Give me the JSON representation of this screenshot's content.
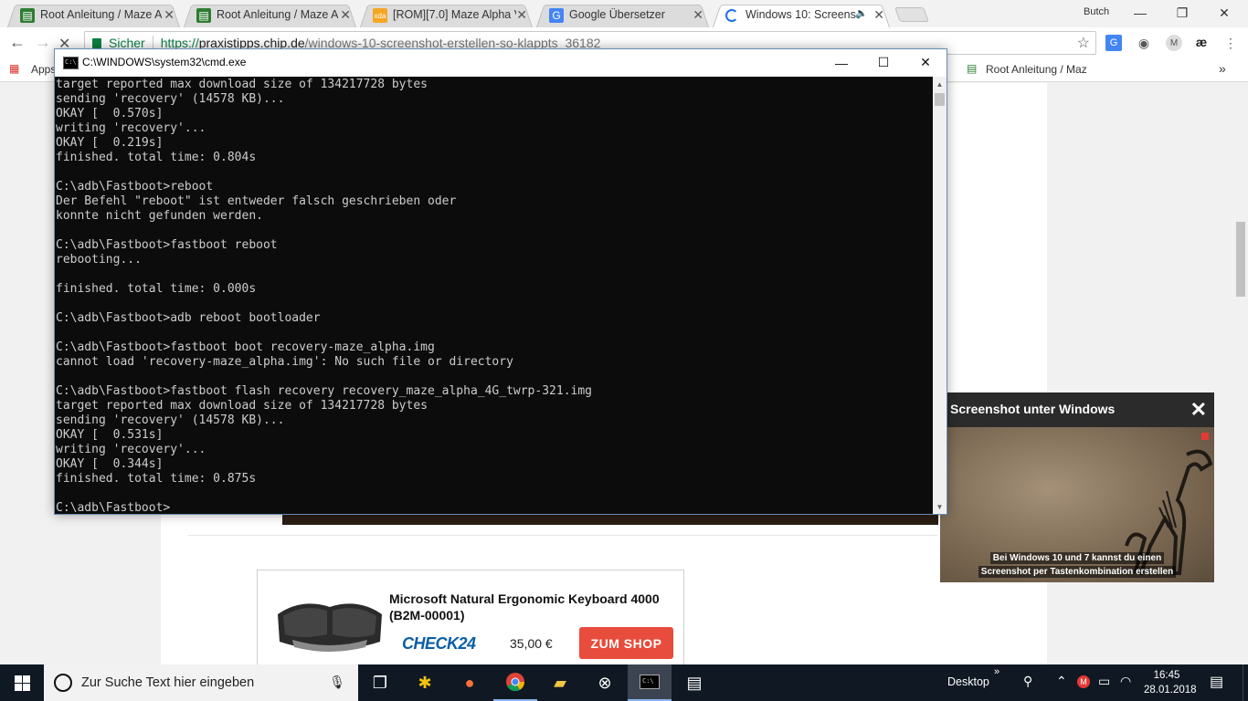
{
  "browser": {
    "tabs": [
      {
        "title": "Root Anleitung / Maze A",
        "favicon": "document-icon",
        "active": false
      },
      {
        "title": "Root Anleitung / Maze A",
        "favicon": "document-icon",
        "active": false
      },
      {
        "title": "[ROM][7.0] Maze Alpha V",
        "favicon": "xda-icon",
        "active": false
      },
      {
        "title": "Google Übersetzer",
        "favicon": "translate-icon",
        "active": false
      },
      {
        "title": "Windows 10: Screens",
        "favicon": "loading-icon",
        "active": true
      }
    ],
    "profile_name": "Butch",
    "omnibox": {
      "secure_label": "Sicher",
      "url_scheme": "https://",
      "url_host": "praxistipps.chip.de",
      "url_path": "/windows-10-screenshot-erstellen-so-klappts_36182"
    },
    "bookmarks": {
      "apps_label": "Apps",
      "items": [
        {
          "label": "Root Anleitung / Maz"
        }
      ],
      "overflow": "»"
    }
  },
  "cmd_window": {
    "title": "C:\\WINDOWS\\system32\\cmd.exe",
    "lines": [
      "target reported max download size of 134217728 bytes",
      "sending 'recovery' (14578 KB)...",
      "OKAY [  0.570s]",
      "writing 'recovery'...",
      "OKAY [  0.219s]",
      "finished. total time: 0.804s",
      "",
      "C:\\adb\\Fastboot>reboot",
      "Der Befehl \"reboot\" ist entweder falsch geschrieben oder",
      "konnte nicht gefunden werden.",
      "",
      "C:\\adb\\Fastboot>fastboot reboot",
      "rebooting...",
      "",
      "finished. total time: 0.000s",
      "",
      "C:\\adb\\Fastboot>adb reboot bootloader",
      "",
      "C:\\adb\\Fastboot>fastboot boot recovery-maze_alpha.img",
      "cannot load 'recovery-maze_alpha.img': No such file or directory",
      "",
      "C:\\adb\\Fastboot>fastboot flash recovery recovery_maze_alpha_4G_twrp-321.img",
      "target reported max download size of 134217728 bytes",
      "sending 'recovery' (14578 KB)...",
      "OKAY [  0.531s]",
      "writing 'recovery'...",
      "OKAY [  0.344s]",
      "finished. total time: 0.875s",
      "",
      "C:\\adb\\Fastboot>"
    ]
  },
  "video_popup": {
    "title": "Screenshot unter Windows",
    "caption_line1": "Bei Windows 10 und 7 kannst du einen",
    "caption_line2": "Screenshot per Tastenkombination erstellen"
  },
  "ad": {
    "product_title": "Microsoft Natural Ergonomic Keyboard 4000 (B2M-00001)",
    "vendor": "CHECK24",
    "price": "35,00 €",
    "cta": "ZUM SHOP"
  },
  "taskbar": {
    "search_placeholder": "Zur Suche Text hier eingeben",
    "desktop_label": "Desktop",
    "time": "16:45",
    "date": "28.01.2018"
  },
  "colors": {
    "cmd_background": "#0c0c0c",
    "cmd_text": "#cccccc",
    "taskbar": "#101923",
    "secure_green": "#0b8043",
    "shop_button": "#e74c3c"
  }
}
